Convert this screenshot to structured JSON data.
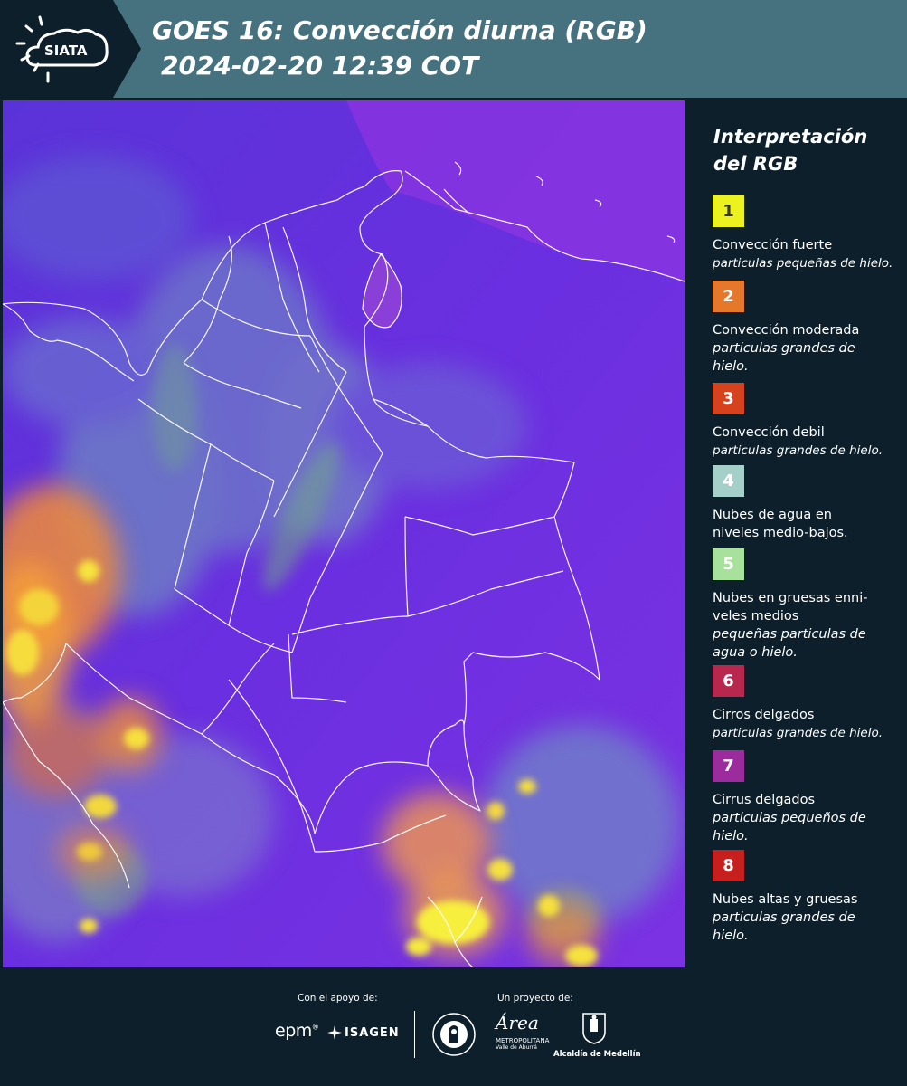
{
  "header": {
    "logo_text": "SIATA",
    "title_line1": "GOES 16: Convección diurna (RGB)",
    "title_line2": "2024-02-20 12:39 COT",
    "background": "#46727f"
  },
  "map": {
    "description_icon": "satellite-rgb-map",
    "background_color": "#5a2fd6"
  },
  "legend": {
    "title_line1": "Interpretación",
    "title_line2": "del RGB",
    "items": [
      {
        "number": "1",
        "color": "#ecf21d",
        "name": [
          "Convección fuerte"
        ],
        "desc": [
          "particulas pequeñas de hielo."
        ]
      },
      {
        "number": "2",
        "color": "#e5782a",
        "name": [
          "Convección moderada"
        ],
        "desc": [
          "particulas grandes de",
          "hielo."
        ]
      },
      {
        "number": "3",
        "color": "#d6411e",
        "name": [
          "Convección debil"
        ],
        "desc": [
          "particulas grandes de hielo."
        ]
      },
      {
        "number": "4",
        "color": "#a5cfc9",
        "name": [
          "Nubes de agua en",
          "niveles medio-bajos."
        ],
        "desc": []
      },
      {
        "number": "5",
        "color": "#a7e19b",
        "name": [
          "Nubes en gruesas enni-",
          "veles medios"
        ],
        "desc": [
          "pequeñas particulas de",
          "agua o hielo."
        ]
      },
      {
        "number": "6",
        "color": "#b8274d",
        "name": [
          "Cirros delgados"
        ],
        "desc": [
          "particulas grandes de hielo."
        ]
      },
      {
        "number": "7",
        "color": "#9c2c9d",
        "name": [
          "Cirrus delgados"
        ],
        "desc": [
          "particulas pequeños de",
          "hielo."
        ]
      },
      {
        "number": "8",
        "color": "#c71e1e",
        "name": [
          "Nubes altas y gruesas"
        ],
        "desc": [
          "particulas grandes de",
          "hielo."
        ]
      }
    ]
  },
  "footer": {
    "support_label": "Con el apoyo de:",
    "project_label": "Un proyecto de:",
    "epm_text": "epm",
    "epm_mark": "®",
    "isagen_text": "ISAGEN",
    "area_word": "Área",
    "area_sub1": "METROPOLITANA",
    "area_sub2": "Valle de Aburrá",
    "medellin_text": "Alcaldía de Medellín"
  }
}
